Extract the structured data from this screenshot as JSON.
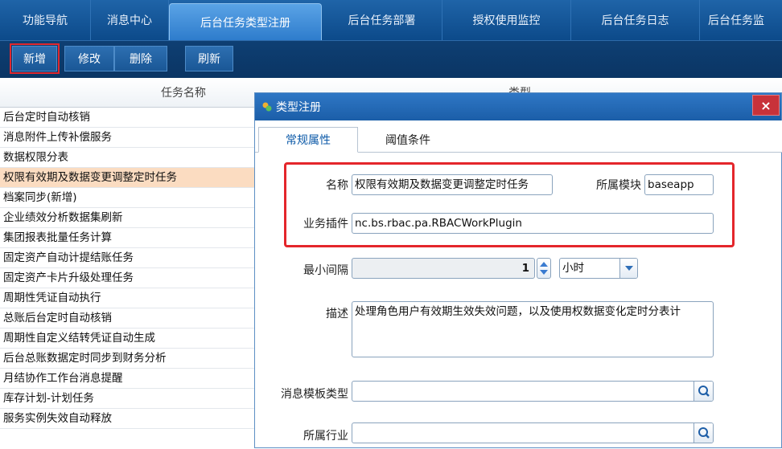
{
  "tabs": [
    {
      "label": "功能导航"
    },
    {
      "label": "消息中心"
    },
    {
      "label": "后台任务类型注册"
    },
    {
      "label": "后台任务部署"
    },
    {
      "label": "授权使用监控"
    },
    {
      "label": "后台任务日志"
    },
    {
      "label": "后台任务监"
    }
  ],
  "toolbar": {
    "add_label": "新增",
    "edit_label": "修改",
    "delete_label": "删除",
    "refresh_label": "刷新"
  },
  "list": {
    "col_name": "任务名称",
    "col_type": "类型",
    "rows": [
      "后台定时自动核销",
      "消息附件上传补偿服务",
      "数据权限分表",
      "权限有效期及数据变更调整定时任务",
      "档案同步(新增)",
      "企业绩效分析数据集刷新",
      "集团报表批量任务计算",
      "固定资产自动计提结账任务",
      "固定资产卡片升级处理任务",
      "周期性凭证自动执行",
      "总账后台定时自动核销",
      "周期性自定义结转凭证自动生成",
      "后台总账数据定时同步到财务分析",
      "月结协作工作台消息提醒",
      "库存计划-计划任务",
      "服务实例失效自动释放"
    ],
    "selected_index": 3
  },
  "dialog": {
    "title": "类型注册",
    "close_label": "×",
    "tab_general": "常规属性",
    "tab_threshold": "阈值条件",
    "name_label": "名称",
    "name_value": "权限有效期及数据变更调整定时任务",
    "module_label": "所属模块",
    "module_value": "baseapp",
    "plugin_label": "业务插件",
    "plugin_value": "nc.bs.rbac.pa.RBACWorkPlugin",
    "interval_label": "最小间隔",
    "interval_value": "1",
    "interval_unit": "小时",
    "desc_label": "描述",
    "desc_value": "处理角色用户有效期生效失效问题，以及使用权数据变化定时分表计",
    "msg_template_label": "消息模板类型",
    "msg_template_value": "",
    "industry_label": "所属行业",
    "industry_value": ""
  },
  "colors": {
    "tab_bg": "#0c4a8a",
    "active_tab": "#2e7ccc",
    "selected_row": "#fbdcc1",
    "highlight_red": "#e4262b"
  }
}
